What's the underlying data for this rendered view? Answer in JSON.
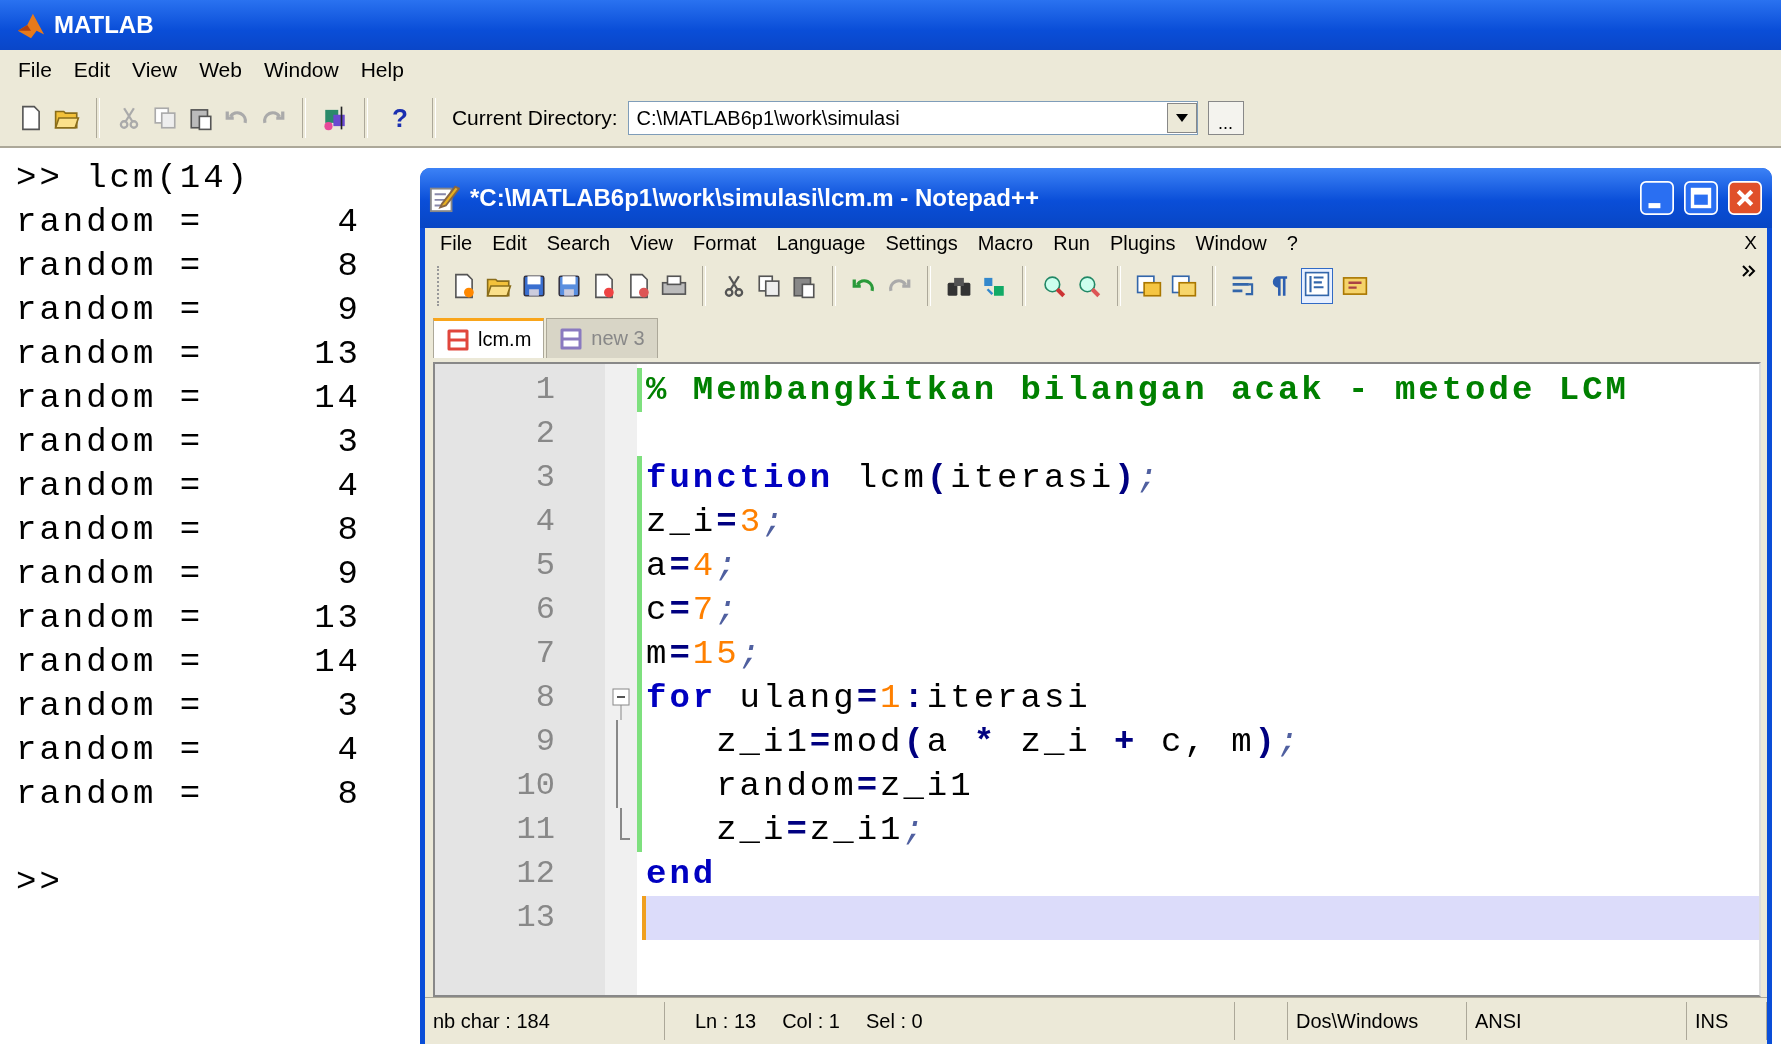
{
  "matlab": {
    "title": "MATLAB",
    "menu": [
      "File",
      "Edit",
      "View",
      "Web",
      "Window",
      "Help"
    ],
    "toolbar": {
      "help_button": "?",
      "current_directory_label": "Current Directory:",
      "current_directory": "C:\\MATLAB6p1\\work\\simulasi",
      "browse_button": "..."
    }
  },
  "console": {
    "lines": [
      {
        "kind": "command",
        "text": ">> lcm(14)"
      },
      {
        "kind": "output",
        "label": "random =",
        "value": "4"
      },
      {
        "kind": "output",
        "label": "random =",
        "value": "8"
      },
      {
        "kind": "output",
        "label": "random =",
        "value": "9"
      },
      {
        "kind": "output",
        "label": "random =",
        "value": "13"
      },
      {
        "kind": "output",
        "label": "random =",
        "value": "14"
      },
      {
        "kind": "output",
        "label": "random =",
        "value": "3"
      },
      {
        "kind": "output",
        "label": "random =",
        "value": "4"
      },
      {
        "kind": "output",
        "label": "random =",
        "value": "8"
      },
      {
        "kind": "output",
        "label": "random =",
        "value": "9"
      },
      {
        "kind": "output",
        "label": "random =",
        "value": "13"
      },
      {
        "kind": "output",
        "label": "random =",
        "value": "14"
      },
      {
        "kind": "output",
        "label": "random =",
        "value": "3"
      },
      {
        "kind": "output",
        "label": "random =",
        "value": "4"
      },
      {
        "kind": "output",
        "label": "random =",
        "value": "8"
      },
      {
        "kind": "blank"
      },
      {
        "kind": "prompt",
        "text": ">>"
      }
    ]
  },
  "notepad": {
    "title": "*C:\\MATLAB6p1\\work\\simulasi\\lcm.m - Notepad++",
    "menu": [
      "File",
      "Edit",
      "Search",
      "View",
      "Format",
      "Language",
      "Settings",
      "Macro",
      "Run",
      "Plugins",
      "Window",
      "?"
    ],
    "close_document": "X",
    "tabs": [
      {
        "label": "lcm.m",
        "selected": true,
        "modified": true
      },
      {
        "label": "new 3",
        "selected": false,
        "modified": false
      }
    ],
    "editor": {
      "lines": [
        {
          "number": "1",
          "changed": true,
          "current": false,
          "tokens": [
            {
              "kind": "comment",
              "text": "% Membangkitkan bilangan acak - metode LCM"
            }
          ]
        },
        {
          "number": "2",
          "changed": false,
          "current": false
        },
        {
          "number": "3",
          "changed": true,
          "current": false,
          "tokens": [
            {
              "kind": "keyword",
              "text": "function"
            },
            {
              "kind": "plain",
              "text": " lcm"
            },
            {
              "kind": "op",
              "text": "("
            },
            {
              "kind": "plain",
              "text": "iterasi"
            },
            {
              "kind": "op",
              "text": ")"
            },
            {
              "kind": "punct",
              "text": ";"
            }
          ]
        },
        {
          "number": "4",
          "changed": true,
          "current": false,
          "tokens": [
            {
              "kind": "plain",
              "text": "z_i"
            },
            {
              "kind": "op",
              "text": "="
            },
            {
              "kind": "number",
              "text": "3"
            },
            {
              "kind": "punct",
              "text": ";"
            }
          ]
        },
        {
          "number": "5",
          "changed": true,
          "current": false,
          "tokens": [
            {
              "kind": "plain",
              "text": "a"
            },
            {
              "kind": "op",
              "text": "="
            },
            {
              "kind": "number",
              "text": "4"
            },
            {
              "kind": "punct",
              "text": ";"
            }
          ]
        },
        {
          "number": "6",
          "changed": true,
          "current": false,
          "tokens": [
            {
              "kind": "plain",
              "text": "c"
            },
            {
              "kind": "op",
              "text": "="
            },
            {
              "kind": "number",
              "text": "7"
            },
            {
              "kind": "punct",
              "text": ";"
            }
          ]
        },
        {
          "number": "7",
          "changed": true,
          "current": false,
          "tokens": [
            {
              "kind": "plain",
              "text": "m"
            },
            {
              "kind": "op",
              "text": "="
            },
            {
              "kind": "number",
              "text": "15"
            },
            {
              "kind": "punct",
              "text": ";"
            }
          ]
        },
        {
          "number": "8",
          "changed": true,
          "current": false,
          "tokens": [
            {
              "kind": "keyword",
              "text": "for"
            },
            {
              "kind": "plain",
              "text": " ulang"
            },
            {
              "kind": "op",
              "text": "="
            },
            {
              "kind": "number",
              "text": "1"
            },
            {
              "kind": "op",
              "text": ":"
            },
            {
              "kind": "plain",
              "text": "iterasi"
            }
          ],
          "children": [
            {
              "number": "9",
              "changed": true,
              "current": false,
              "tokens": [
                {
                  "kind": "plain",
                  "text": "   z_i1"
                },
                {
                  "kind": "op",
                  "text": "="
                },
                {
                  "kind": "plain",
                  "text": "mod"
                },
                {
                  "kind": "op",
                  "text": "("
                },
                {
                  "kind": "plain",
                  "text": "a "
                },
                {
                  "kind": "op",
                  "text": "*"
                },
                {
                  "kind": "plain",
                  "text": " z_i "
                },
                {
                  "kind": "op",
                  "text": "+"
                },
                {
                  "kind": "plain",
                  "text": " c, m"
                },
                {
                  "kind": "op",
                  "text": ")"
                },
                {
                  "kind": "punct",
                  "text": ";"
                }
              ]
            },
            {
              "number": "10",
              "changed": true,
              "current": false,
              "tokens": [
                {
                  "kind": "plain",
                  "text": "   random"
                },
                {
                  "kind": "op",
                  "text": "="
                },
                {
                  "kind": "plain",
                  "text": "z_i1"
                }
              ]
            },
            {
              "number": "11",
              "changed": true,
              "current": false,
              "tokens": [
                {
                  "kind": "plain",
                  "text": "   z_i"
                },
                {
                  "kind": "op",
                  "text": "="
                },
                {
                  "kind": "plain",
                  "text": "z_i1"
                },
                {
                  "kind": "punct",
                  "text": ";"
                }
              ]
            }
          ]
        },
        {
          "number": "12",
          "changed": false,
          "current": false,
          "tokens": [
            {
              "kind": "keyword",
              "text": "end"
            }
          ]
        },
        {
          "number": "13",
          "changed": false,
          "current": true
        }
      ]
    },
    "status_bar": [
      [
        "nb char : 184"
      ],
      [
        "Ln : 13",
        "Col : 1",
        "Sel : 0"
      ],
      [
        "Dos\\Windows"
      ],
      [
        "ANSI"
      ],
      [
        "INS"
      ]
    ]
  }
}
